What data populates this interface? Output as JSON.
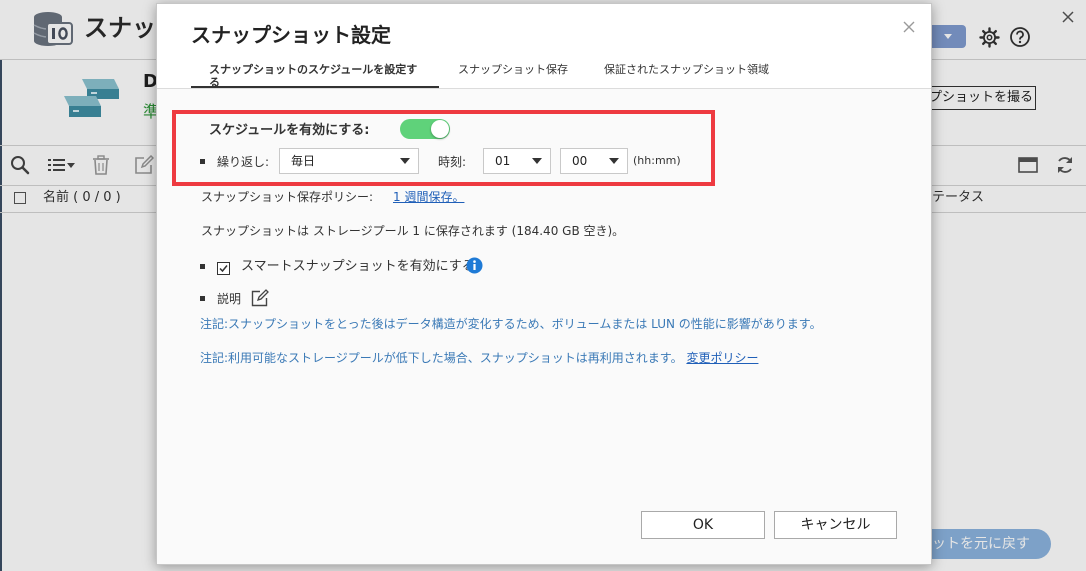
{
  "background_app": {
    "title_fragment": "スナッ",
    "volume_name_fragment": "D",
    "volume_status_fragment": "準",
    "take_snapshot_button_fragment": "プショットを撮る",
    "restore_button_fragment": "ットを元に戻す",
    "table": {
      "name_column_header": "名前 ( 0 / 0 )",
      "status_column_header_fragment": "テータス"
    },
    "header_icons": [
      "storage-app-icon",
      "settings-gear-icon",
      "help-icon",
      "window-close-icon"
    ],
    "toolbar_icons": [
      "search-icon",
      "list-view-icon",
      "trash-icon",
      "edit-icon",
      "window-icon",
      "refresh-icon"
    ]
  },
  "dialog": {
    "title": "スナップショット設定",
    "tabs": [
      {
        "label": "スナップショットのスケジュールを設定する",
        "active": true
      },
      {
        "label": "スナップショット保存",
        "active": false
      },
      {
        "label": "保証されたスナップショット領域",
        "active": false
      }
    ],
    "schedule": {
      "enable_label": "スケジュールを有効にする:",
      "enabled": true,
      "repeat_label": "繰り返し:",
      "repeat_value": "毎日",
      "time_label": "時刻:",
      "hour_value": "01",
      "minute_value": "00",
      "time_format_hint": "(hh:mm)"
    },
    "retention_policy": {
      "label": "スナップショット保存ポリシー:",
      "value_link": "1 週間保存。"
    },
    "storage_info": "スナップショットは ストレージプール 1 に保存されます (184.40 GB 空き)。",
    "smart_snapshot": {
      "label": "スマートスナップショットを有効にする",
      "checked": true
    },
    "description_label": "説明",
    "note_performance": "注記:スナップショットをとった後はデータ構造が変化するため、ボリュームまたは LUN の性能に影響があります。",
    "note_recycle": {
      "text": "注記:利用可能なストレージプールが低下した場合、スナップショットは再利用されます。",
      "link": "変更ポリシー"
    },
    "buttons": {
      "ok": "OK",
      "cancel": "キャンセル"
    }
  },
  "colors": {
    "toggle_on": "#5fd27a",
    "highlight_border": "#ee3a40",
    "link": "#1f5fb8",
    "note_text": "#3a79b6",
    "primary_button": "#8cb4df",
    "account_button": "#7f9bd0"
  }
}
